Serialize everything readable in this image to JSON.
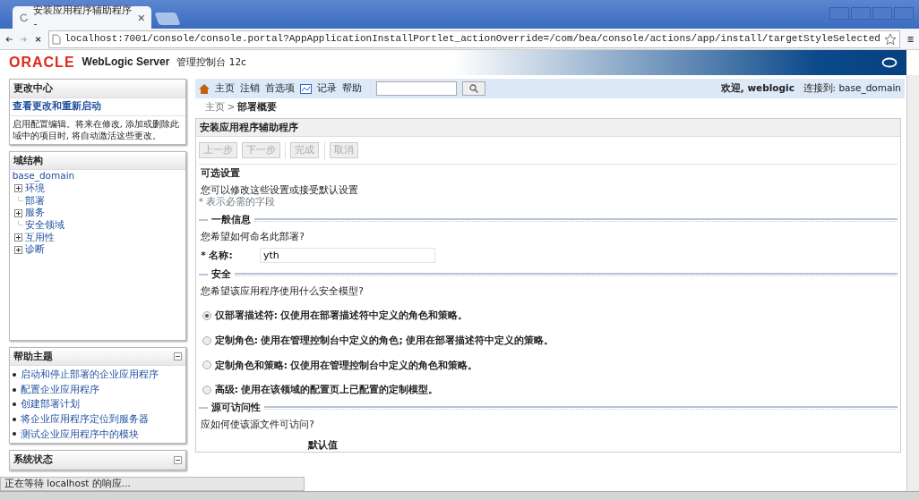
{
  "browser": {
    "tab_title": "安装应用程序辅助程序 -",
    "address": "localhost:7001/console/console.portal?AppApplicationInstallPortlet_actionOverride=/com/bea/console/actions/app/install/targetStyleSelected"
  },
  "header": {
    "logo": "ORACLE",
    "product": "WebLogic Server",
    "console": "管理控制台 12c"
  },
  "change_center": {
    "title": "更改中心",
    "link": "查看更改和重新启动",
    "description": "启用配置编辑。将来在修改, 添加或删除此域中的项目时, 将自动激活这些更改。"
  },
  "domain_structure": {
    "title": "域结构",
    "root": "base_domain",
    "children": [
      {
        "label": "环境",
        "expandable": true
      },
      {
        "label": "部署",
        "expandable": false
      },
      {
        "label": "服务",
        "expandable": true
      },
      {
        "label": "安全领域",
        "expandable": false
      },
      {
        "label": "互用性",
        "expandable": true
      },
      {
        "label": "诊断",
        "expandable": true
      }
    ]
  },
  "help_topics": {
    "title": "帮助主题",
    "links": [
      "启动和停止部署的企业应用程序",
      "配置企业应用程序",
      "创建部署计划",
      "将企业应用程序定位到服务器",
      "测试企业应用程序中的模块"
    ]
  },
  "system_status": {
    "title": "系统状态"
  },
  "toolbar": {
    "items": [
      {
        "label": "主页",
        "kind": "home"
      },
      {
        "label": "注销",
        "kind": "text"
      },
      {
        "label": "首选项",
        "kind": "text"
      },
      {
        "label": "记录",
        "kind": "record"
      },
      {
        "label": "帮助",
        "kind": "text"
      }
    ],
    "welcome": "欢迎, weblogic",
    "connection": "连接到: base_domain"
  },
  "breadcrumb": {
    "home": "主页 >",
    "current": "部署概要"
  },
  "panel": {
    "title": "安装应用程序辅助程序",
    "buttons": [
      {
        "label": "上一步",
        "disabled": true
      },
      {
        "label": "下一步",
        "disabled": true
      },
      {
        "label": "完成",
        "disabled": true
      },
      {
        "label": "取消",
        "disabled": true
      }
    ],
    "heading": "可选设置",
    "intro": "您可以修改这些设置或接受默认设置",
    "required_note": "* 表示必需的字段",
    "sections": [
      {
        "title": "一般信息",
        "question": "您希望如何命名此部署?",
        "field": {
          "label": "* 名称:",
          "value": "yth"
        }
      },
      {
        "title": "安全",
        "question": "您希望该应用程序使用什么安全模型?",
        "options": [
          {
            "label": "仅部署描述符: 仅使用在部署描述符中定义的角色和策略。",
            "selected": true
          },
          {
            "label": "定制角色: 使用在管理控制台中定义的角色; 使用在部署描述符中定义的策略。",
            "selected": false
          },
          {
            "label": "定制角色和策略: 仅使用在管理控制台中定义的角色和策略。",
            "selected": false
          },
          {
            "label": "高级: 使用在该领域的配置页上已配置的定制模型。",
            "selected": false
          }
        ]
      },
      {
        "title": "源可访问性",
        "question": "应如何使该源文件可访问?",
        "partial_option": "默认值"
      }
    ]
  },
  "status_bubble": "正在等待 localhost 的响应..."
}
